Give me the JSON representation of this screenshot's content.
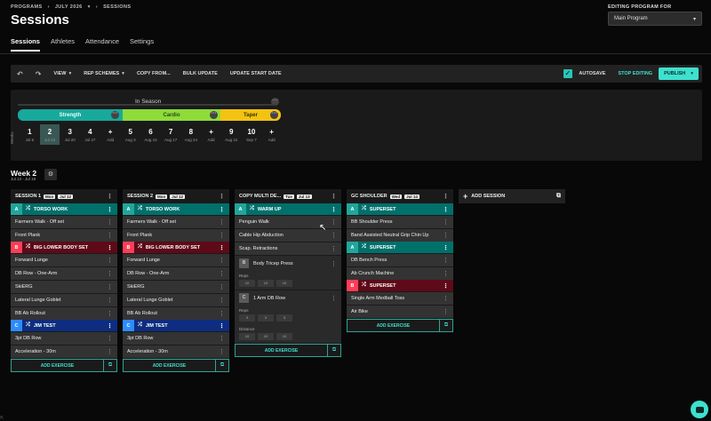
{
  "breadcrumb": [
    "PROGRAMS",
    "JULY 2026",
    "SESSIONS"
  ],
  "page_title": "Sessions",
  "program": {
    "label": "EDITING PROGRAM FOR",
    "value": "Main Program"
  },
  "tabs": [
    "Sessions",
    "Athletes",
    "Attendance",
    "Settings"
  ],
  "toolbar": {
    "view": "VIEW",
    "rep": "REP SCHEMES",
    "copy": "COPY FROM...",
    "bulk": "BULK UPDATE",
    "start": "UPDATE START DATE",
    "autosave": "AUTOSAVE",
    "stop": "STOP EDITING",
    "publish": "PUBLISH"
  },
  "timeline": {
    "season": "In Season",
    "phases": [
      "Strength",
      "Cardio",
      "Taper"
    ],
    "side_label": "Weeks",
    "weeks": [
      {
        "n": "1",
        "d": "Jul 6"
      },
      {
        "n": "2",
        "d": "Jul 13"
      },
      {
        "n": "3",
        "d": "Jul 20"
      },
      {
        "n": "4",
        "d": "Jul 27"
      },
      {
        "n": "+",
        "d": "Add"
      },
      {
        "n": "5",
        "d": "Aug 3"
      },
      {
        "n": "6",
        "d": "Aug 10"
      },
      {
        "n": "7",
        "d": "Aug 17"
      },
      {
        "n": "8",
        "d": "Aug 24"
      },
      {
        "n": "+",
        "d": "Add"
      },
      {
        "n": "9",
        "d": "Aug 31"
      },
      {
        "n": "10",
        "d": "Sep 7"
      },
      {
        "n": "+",
        "d": "Add"
      }
    ]
  },
  "week": {
    "title": "Week 2",
    "dates": "Jul 13 - Jul 19"
  },
  "add_exercise": "ADD EXERCISE",
  "add_session": "ADD SESSION",
  "sessions": [
    {
      "title": "SESSION 1",
      "day": "Mon",
      "date": "Jul 12",
      "groups": [
        {
          "letter": "A",
          "name": "TORSO WORK",
          "ex": [
            "Farmers Walk - Off set",
            "Front Plank"
          ]
        },
        {
          "letter": "B",
          "name": "BIG LOWER BODY SET",
          "ex": [
            "Forward Lunge",
            "DB Row - One-Arm",
            "SkiERG",
            "Lateral Lunge Goblet",
            "BB Ab Rollout"
          ]
        },
        {
          "letter": "C",
          "name": "JIM TEST",
          "ex": [
            "3pt DB Row",
            "Acceleration - 30m"
          ]
        }
      ]
    },
    {
      "title": "SESSION 2",
      "day": "Mon",
      "date": "Jul 12",
      "groups": [
        {
          "letter": "A",
          "name": "TORSO WORK",
          "ex": [
            "Farmers Walk - Off set",
            "Front Plank"
          ]
        },
        {
          "letter": "B",
          "name": "BIG LOWER BODY SET",
          "ex": [
            "Forward Lunge",
            "DB Row - One-Arm",
            "SkiERG",
            "Lateral Lunge Goblet",
            "BB Ab Rollout"
          ]
        },
        {
          "letter": "C",
          "name": "JIM TEST",
          "ex": [
            "3pt DB Row",
            "Acceleration - 30m"
          ]
        }
      ]
    },
    {
      "title": "COPY MULTI DE...",
      "day": "Tue",
      "date": "Jul 13",
      "groupA": {
        "letter": "A",
        "name": "WARM UP",
        "ex": [
          "Penguin Walk",
          "Cable Hip Abduction",
          "Scap. Retractions"
        ]
      },
      "blockB": {
        "letter": "B",
        "name": "Body Tricep Press",
        "param": "Reps",
        "vals": [
          "10",
          "10",
          "10"
        ]
      },
      "blockC": {
        "letter": "C",
        "name": "1 Arm DB Row",
        "p1": "Reps",
        "v1": [
          "3",
          "3",
          "3"
        ],
        "p2": "Distance",
        "v2": [
          "10",
          "10",
          "10"
        ]
      }
    },
    {
      "title": "GC SHOULDER",
      "day": "Wed",
      "date": "Jul 14",
      "groups": [
        {
          "letter": "A",
          "name": "SUPERSET",
          "ex": [
            "BB Shoulder Press",
            "Band Assisted Neutral Grip Chin Up"
          ]
        },
        {
          "letter": "A",
          "name": "SUPERSET",
          "ex": [
            "DB Bench Press",
            "Ab Crunch Machine"
          ]
        },
        {
          "letter": "B",
          "name": "SUPERSET",
          "ex": [
            "Single Arm Medball Toss",
            "Air Bike"
          ]
        }
      ]
    }
  ],
  "colors": {
    "accent": "#3ee0cf",
    "strength": "#17a99c",
    "cardio": "#8edb3a",
    "taper": "#f2c313"
  }
}
